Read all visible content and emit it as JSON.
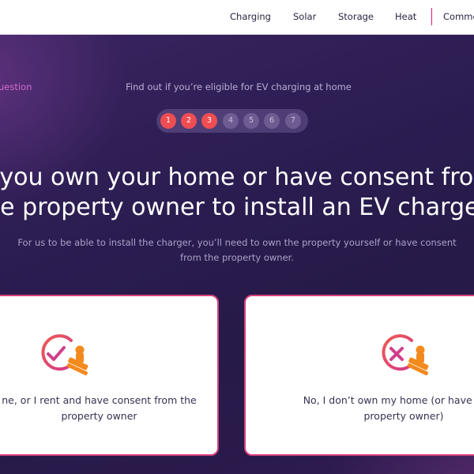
{
  "nav": {
    "items": [
      "Charging",
      "Solar",
      "Storage",
      "Heat",
      "Comme"
    ]
  },
  "hero": {
    "back_link": "uestion",
    "eligibility_text": "Find out if you’re eligible for EV charging at home",
    "steps": [
      "1",
      "2",
      "3",
      "4",
      "5",
      "6",
      "7"
    ],
    "completed_steps": 3,
    "question_line1": "o you own your home or have consent from",
    "question_line2": "he property owner to install an EV charger",
    "subtext_line1": "For us to be able to install the charger, you’ll need to own the property yourself or have consent",
    "subtext_line2": "from the property owner."
  },
  "options": [
    {
      "icon": "approve-stamp-icon",
      "line1": "ne, or I rent and have consent from the",
      "line2": "property owner"
    },
    {
      "icon": "reject-stamp-icon",
      "line1": "No, I don’t own my home (or have conse",
      "line2": "property owner)"
    }
  ],
  "colors": {
    "accent": "#ee4d52",
    "brand_pink": "#d5417b",
    "background": "#2a1a4a"
  }
}
